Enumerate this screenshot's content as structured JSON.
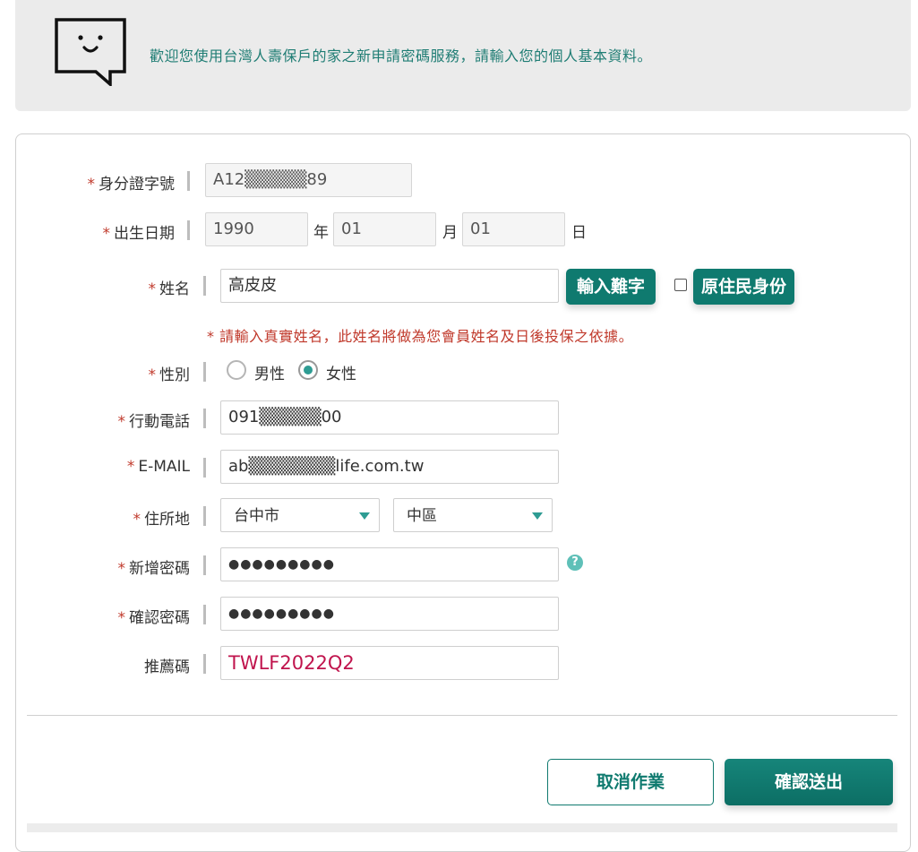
{
  "banner": {
    "welcome_text": "歡迎您使用台灣人壽保戶的家之新申請密碼服務，請輸入您的個人基本資料。",
    "icon": "smiley-chat-icon"
  },
  "form": {
    "id_number": {
      "label": "身分證字號",
      "required": "*",
      "value": "A12▒▒▒▒▒89"
    },
    "birth_date": {
      "label": "出生日期",
      "required": "*",
      "year": "1990",
      "year_unit": "年",
      "month": "01",
      "month_unit": "月",
      "day": "01",
      "day_unit": "日"
    },
    "name": {
      "label": "姓名",
      "required": "*",
      "value": "高皮皮",
      "rare_char_button": "輸入難字",
      "indigenous_label": "原住民身份",
      "note": "* 請輸入真實姓名，此姓名將做為您會員姓名及日後投保之依據。"
    },
    "gender": {
      "label": "性別",
      "required": "*",
      "options": [
        "男性",
        "女性"
      ],
      "selected": "女性"
    },
    "mobile": {
      "label": "行動電話",
      "required": "*",
      "value": "091▒▒▒▒▒00"
    },
    "email": {
      "label": "E-MAIL",
      "required": "*",
      "value": "ab▒▒▒▒▒▒▒life.com.tw"
    },
    "address": {
      "label": "住所地",
      "required": "*",
      "city": "台中市",
      "district": "中區"
    },
    "new_password": {
      "label": "新增密碼",
      "required": "*",
      "value": "●●●●●●●●●",
      "help": "?"
    },
    "confirm_password": {
      "label": "確認密碼",
      "required": "*",
      "value": "●●●●●●●●●"
    },
    "referral": {
      "label": "推薦碼",
      "value": "TWLF2022Q2"
    }
  },
  "actions": {
    "cancel_label": "取消作業",
    "submit_label": "確認送出"
  },
  "colors": {
    "accent": "#0f7a6f",
    "welcome_text": "#1f7d74",
    "required": "#c0392b",
    "promo": "#c0144d"
  }
}
